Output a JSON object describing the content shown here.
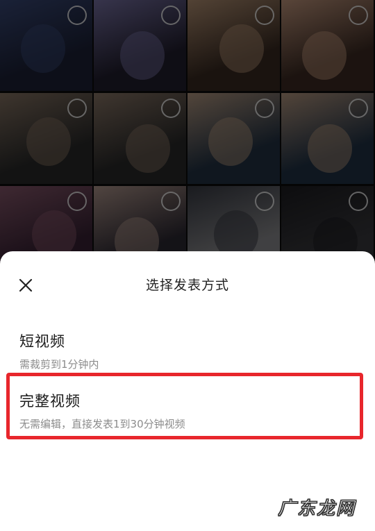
{
  "gallery": {
    "thumbnails": [
      {
        "id": 1,
        "bg": "#1d2238",
        "accent": "#3a4a7a"
      },
      {
        "id": 2,
        "bg": "#232030",
        "accent": "#7a74a8"
      },
      {
        "id": 3,
        "bg": "#3a2b22",
        "accent": "#b79476"
      },
      {
        "id": 4,
        "bg": "#3e2c24",
        "accent": "#c69a80"
      },
      {
        "id": 5,
        "bg": "#2c2c2c",
        "accent": "#8a7766"
      },
      {
        "id": 6,
        "bg": "#2b2b2b",
        "accent": "#8e7a6a"
      },
      {
        "id": 7,
        "bg": "#243446",
        "accent": "#b89c84"
      },
      {
        "id": 8,
        "bg": "#223448",
        "accent": "#b89a82"
      },
      {
        "id": 9,
        "bg": "#3a2336",
        "accent": "#8a5a6e"
      },
      {
        "id": 10,
        "bg": "#2e2a34",
        "accent": "#b49a90"
      },
      {
        "id": 11,
        "bg": "#8f8f92",
        "accent": "#3a3d46"
      },
      {
        "id": 12,
        "bg": "#3a3a3e",
        "accent": "#1e1e22"
      }
    ]
  },
  "sheet": {
    "title": "选择发表方式",
    "options": [
      {
        "label": "短视频",
        "description": "需裁剪到1分钟内"
      },
      {
        "label": "完整视频",
        "description": "无需编辑，直接发表1到30分钟视频"
      }
    ],
    "highlight_color": "#e8262c"
  },
  "watermark": "广东龙网"
}
